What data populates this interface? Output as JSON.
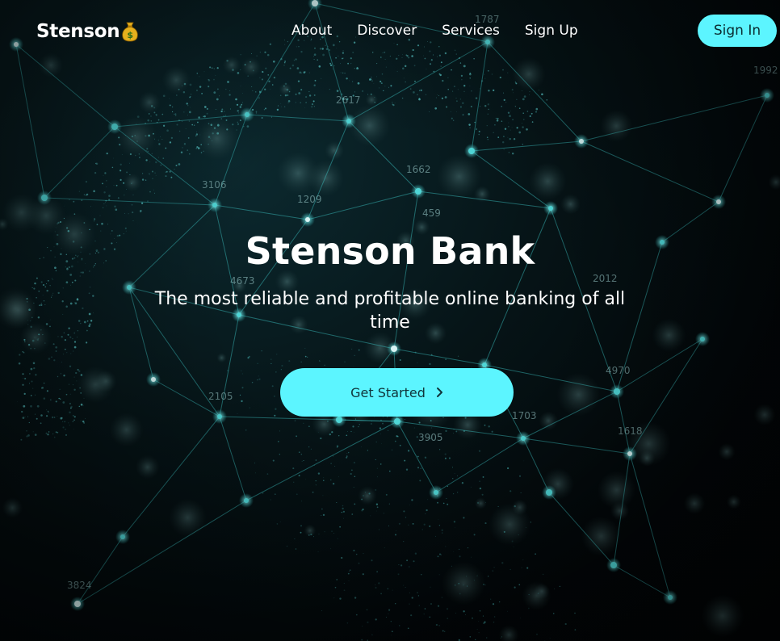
{
  "brand": {
    "name": "Stenson",
    "icon": "money-bag-icon",
    "icon_color": "#e5b01d"
  },
  "nav": {
    "links": [
      {
        "label": "About"
      },
      {
        "label": "Discover"
      },
      {
        "label": "Services"
      },
      {
        "label": "Sign Up"
      }
    ],
    "signin_label": "Sign In"
  },
  "hero": {
    "title": "Stenson Bank",
    "subtitle": "The most reliable and profitable online banking of all time",
    "cta_label": "Get Started",
    "cta_icon": "chevron-right-icon"
  },
  "background": {
    "node_labels": [
      "1787",
      "2617",
      "1662",
      "3106",
      "1209",
      "459",
      "4673",
      "2012",
      "4970",
      "2105",
      "1703",
      "1618",
      "3905",
      "3824",
      "1992"
    ]
  },
  "colors": {
    "accent": "#5cf5ff",
    "text": "#ffffff",
    "background": "#03080c",
    "network": "#3fc9c9"
  }
}
